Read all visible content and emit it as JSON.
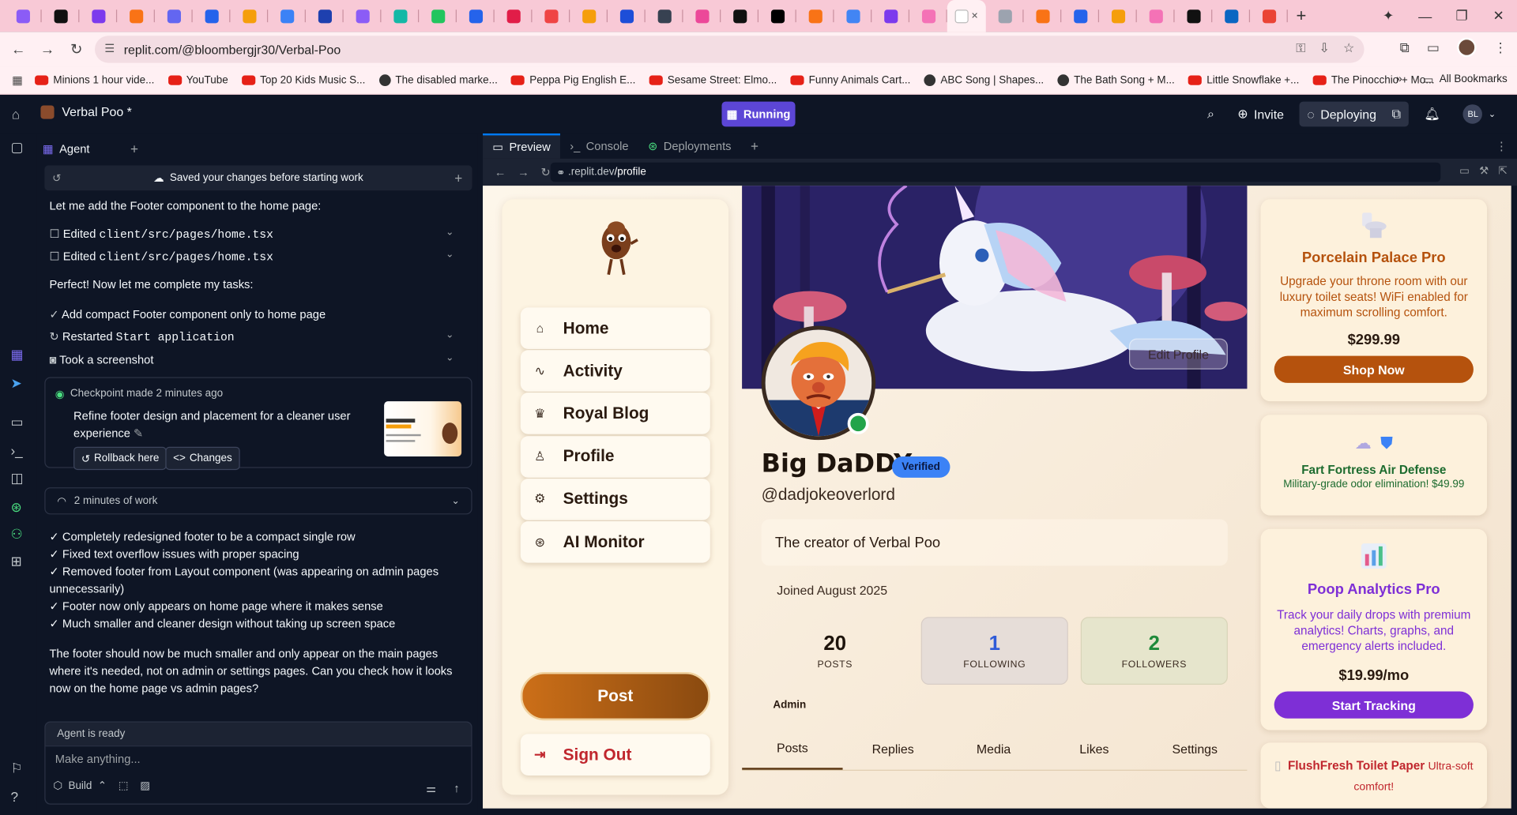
{
  "browser": {
    "tab_count": 36,
    "favicon_colors": [
      "#8b5cf6",
      "#111111",
      "#7c3aed",
      "#f97316",
      "#6366f1",
      "#2563eb",
      "#f59e0b",
      "#3b82f6",
      "#1e40af",
      "#8b5cf6",
      "#14b8a6",
      "#22c55e",
      "#2563eb",
      "#e11d48",
      "#ef4444",
      "#f59e0b",
      "#1d4ed8",
      "#374151",
      "#ec4899",
      "#111111",
      "#000000",
      "#f97316",
      "#4285f4",
      "#7c3aed",
      "#f472b6",
      "#ffffff",
      "#9ca3af",
      "#f97316",
      "#2563eb",
      "#f59e0b",
      "#f472b6",
      "#111111",
      "#0a66c2",
      "#ea4335"
    ],
    "active_tab_index": 25,
    "new_tab_label": "+",
    "address_url": "replit.com/@bloombergjr30/Verbal-Poo",
    "bookmarks": [
      {
        "label": "Minions 1 hour vide...",
        "icon": "youtube-icon"
      },
      {
        "label": "YouTube",
        "icon": "youtube-icon"
      },
      {
        "label": "Top 20 Kids Music S...",
        "icon": "youtube-icon"
      },
      {
        "label": "The disabled marke...",
        "icon": "globe-icon"
      },
      {
        "label": "Peppa Pig English E...",
        "icon": "youtube-icon"
      },
      {
        "label": "Sesame Street: Elmo...",
        "icon": "youtube-icon"
      },
      {
        "label": "Funny Animals Cart...",
        "icon": "youtube-icon"
      },
      {
        "label": "ABC Song | Shapes...",
        "icon": "globe-icon"
      },
      {
        "label": "The Bath Song + M...",
        "icon": "globe-icon"
      },
      {
        "label": "Little Snowflake +...",
        "icon": "youtube-icon"
      },
      {
        "label": "The Pinocchio + Mo...",
        "icon": "youtube-icon"
      }
    ],
    "all_bookmarks": "All Bookmarks"
  },
  "replit": {
    "project_name": "Verbal Poo *",
    "run_status": "Running",
    "invite": "Invite",
    "deploying": "Deploying",
    "user_initials": "BL"
  },
  "agent": {
    "tab_label": "Agent",
    "saved_banner": "Saved your changes before starting work",
    "intro": "Let me add the Footer component to the home page:",
    "edit_label": "Edited",
    "edit_path": "client/src/pages/home.tsx",
    "perfect": "Perfect! Now let me complete my tasks:",
    "task_done": "Add compact Footer component only to home page",
    "restarted_prefix": "Restarted",
    "restarted_target": "Start application",
    "screenshot": "Took a screenshot",
    "checkpoint": {
      "heading": "Checkpoint made 2 minutes ago",
      "desc": "Refine footer design and placement for a cleaner user experience",
      "rollback": "Rollback here",
      "changes": "Changes"
    },
    "work_label": "2 minutes of work",
    "summary": [
      "✓ Completely redesigned footer to be a compact single row",
      "✓ Fixed text overflow issues with proper spacing",
      "✓ Removed footer from Layout component (was appearing on admin pages unnecessarily)",
      "✓ Footer now only appears on home page where it makes sense",
      "✓ Much smaller and cleaner design without taking up screen space"
    ],
    "closing": "The footer should now be much smaller and only appear on the main pages where it's needed, not on admin or settings pages. Can you check how it looks now on the home page vs admin pages?",
    "status": "Agent is ready",
    "placeholder": "Make anything...",
    "mode": "Build"
  },
  "preview": {
    "tabs": [
      "Preview",
      "Console",
      "Deployments"
    ],
    "url_prefix": ".replit.dev",
    "url_path": "/profile"
  },
  "site": {
    "nav": [
      {
        "label": "Home",
        "icon": "home-icon"
      },
      {
        "label": "Activity",
        "icon": "activity-icon"
      },
      {
        "label": "Royal Blog",
        "icon": "crown-icon"
      },
      {
        "label": "Profile",
        "icon": "user-icon"
      },
      {
        "label": "Settings",
        "icon": "gear-icon"
      },
      {
        "label": "AI Monitor",
        "icon": "brain-icon"
      }
    ],
    "post": "Post",
    "sign_out": "Sign Out",
    "edit_profile": "Edit Profile",
    "name": "Big DaDDY",
    "verified": "Verified",
    "handle": "@dadjokeoverlord",
    "bio": "The creator of Verbal Poo",
    "joined": "Joined August 2025",
    "stats": [
      {
        "value": "20",
        "label": "POSTS",
        "color": "#1e140c",
        "bg": "transparent"
      },
      {
        "value": "1",
        "label": "FOLLOWING",
        "color": "#2f5bd8",
        "bg": "#e6ddd8"
      },
      {
        "value": "2",
        "label": "FOLLOWERS",
        "color": "#1f8a3a",
        "bg": "#e6e5cc"
      }
    ],
    "role": "Admin",
    "profile_tabs": [
      "Posts",
      "Replies",
      "Media",
      "Likes",
      "Settings"
    ],
    "ads": [
      {
        "title": "Porcelain Palace Pro",
        "desc": "Upgrade your throne room with our luxury toilet seats! WiFi enabled for maximum scrolling comfort.",
        "price": "$299.99",
        "cta": "Shop Now",
        "color": "#b5520d"
      },
      {
        "title": "Fart Fortress Air Defense",
        "desc": "Military-grade odor elimination! $49.99",
        "color": "#1c6b2e"
      },
      {
        "title": "Poop Analytics Pro",
        "desc": "Track your daily drops with premium analytics! Charts, graphs, and emergency alerts included.",
        "price": "$19.99/mo",
        "cta": "Start Tracking",
        "color": "#7e2fd6"
      },
      {
        "title": "FlushFresh Toilet Paper",
        "desc": "Ultra-soft comfort!",
        "color": "#c0262d"
      }
    ]
  }
}
